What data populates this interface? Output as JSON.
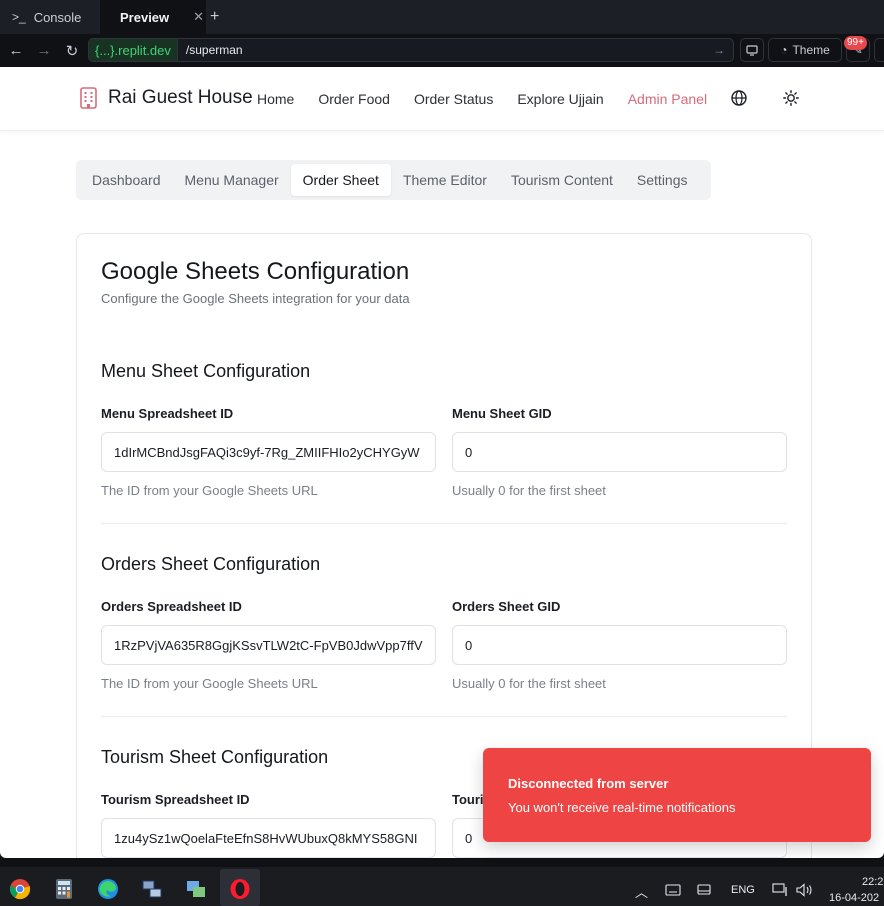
{
  "browser": {
    "tabs": [
      {
        "label": "Console",
        "icon": "terminal-icon"
      },
      {
        "label": "Preview",
        "icon": "monitor-icon"
      }
    ],
    "url_domain": "{...}.replit.dev",
    "url_path": "/superman",
    "theme_label": "Theme",
    "notifications_badge": "99+"
  },
  "header": {
    "brand": "Rai Guest House",
    "nav": [
      "Home",
      "Order Food",
      "Order Status",
      "Explore Ujjain",
      "Admin Panel"
    ]
  },
  "subtabs": [
    "Dashboard",
    "Menu Manager",
    "Order Sheet",
    "Theme Editor",
    "Tourism Content",
    "Settings"
  ],
  "active_subtab": "Order Sheet",
  "card": {
    "title": "Google Sheets Configuration",
    "description": "Configure the Google Sheets integration for your data",
    "sections": [
      {
        "title": "Menu Sheet Configuration",
        "id_label": "Menu Spreadsheet ID",
        "id_value": "1dIrMCBndJsgFAQi3c9yf-7Rg_ZMIIFHIo2yCHYGyW",
        "id_help": "The ID from your Google Sheets URL",
        "gid_label": "Menu Sheet GID",
        "gid_value": "0",
        "gid_help": "Usually 0 for the first sheet"
      },
      {
        "title": "Orders Sheet Configuration",
        "id_label": "Orders Spreadsheet ID",
        "id_value": "1RzPVjVA635R8GgjKSsvTLW2tC-FpVB0JdwVpp7ffV",
        "id_help": "The ID from your Google Sheets URL",
        "gid_label": "Orders Sheet GID",
        "gid_value": "0",
        "gid_help": "Usually 0 for the first sheet"
      },
      {
        "title": "Tourism Sheet Configuration",
        "id_label": "Tourism Spreadsheet ID",
        "id_value": "1zu4ySz1wQoelaFteEfnS8HvWUbuxQ8kMYS58GNI",
        "gid_label": "Touri",
        "gid_value": "0"
      }
    ]
  },
  "toast": {
    "title": "Disconnected from server",
    "message": "You won't receive real-time notifications",
    "color": "#ef4444"
  },
  "taskbar": {
    "language": "ENG",
    "time": "22:2",
    "date": "16-04-202"
  }
}
